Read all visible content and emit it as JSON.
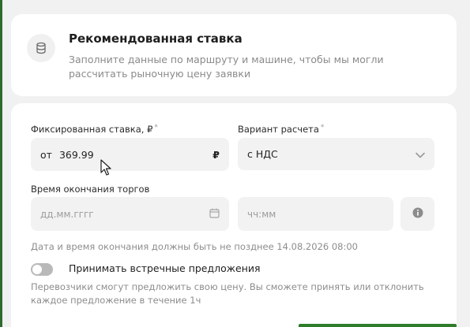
{
  "header": {
    "title": "Рекомендованная ставка",
    "description": "Заполните данные по маршруту и машине, чтобы мы могли рассчитать рыночную цену заявки",
    "icon": "database-icon"
  },
  "form": {
    "fixed_rate_label": "Фиксированная ставка, ₽",
    "required_mark": "*",
    "rate_prefix": "от",
    "rate_value": "369.99",
    "rate_currency": "₽",
    "calc_variant_label": "Вариант расчета",
    "calc_variant_value": "с НДС",
    "end_time_label": "Время окончания торгов",
    "date_placeholder": "дд.мм.гггг",
    "time_placeholder": "чч:мм",
    "deadline_hint": "Дата и время окончания должны быть не позднее 14.08.2026 08:00",
    "counter_offers_label": "Принимать встречные предложения",
    "counter_offers_enabled": false,
    "counter_offers_hint": "Перевозчики смогут предложить свою цену. Вы сможете принять или отклонить каждое предложение в течение 1ч"
  },
  "colors": {
    "accent": "#2f7d2a",
    "field_bg": "#f2f2f2",
    "page_bg": "#f1f1f1"
  }
}
